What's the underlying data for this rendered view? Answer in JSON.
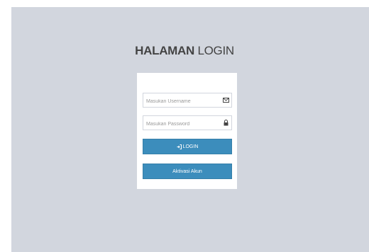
{
  "header": {
    "title_bold": "HALAMAN",
    "title_rest": "LOGIN"
  },
  "form": {
    "username_placeholder": "Masukan Username",
    "password_placeholder": "Masukan Password",
    "login_label": "LOGIN",
    "activate_label": "Aktivasi Akun"
  },
  "icons": {
    "username": "envelope-icon",
    "password": "lock-icon",
    "login": "sign-in-icon"
  },
  "colors": {
    "background": "#d2d6de",
    "button": "#3c8dbc",
    "title": "#444444"
  }
}
